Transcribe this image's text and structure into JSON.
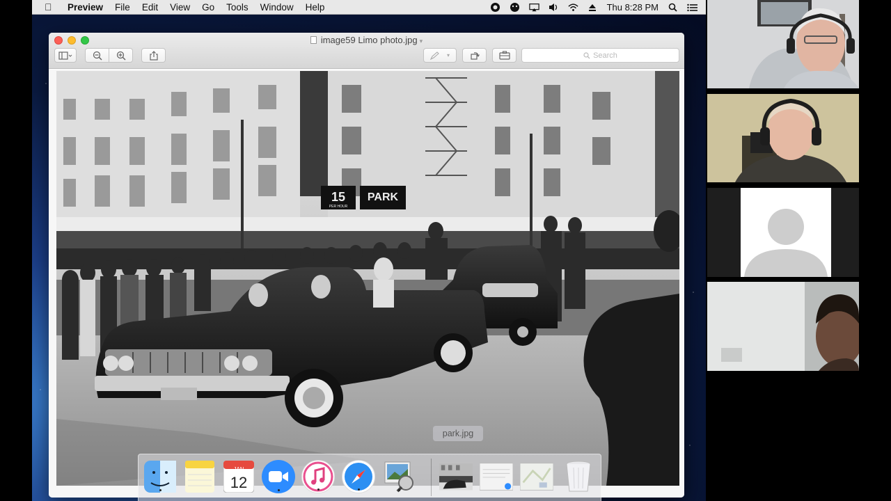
{
  "menubar": {
    "app_name": "Preview",
    "menus": [
      "File",
      "Edit",
      "View",
      "Go",
      "Tools",
      "Window",
      "Help"
    ],
    "clock": "Thu 8:28 PM"
  },
  "window": {
    "title": "image59 Limo photo.jpg",
    "search_placeholder": "Search"
  },
  "photo": {
    "sign_15": "15",
    "sign_per_hour": "PER HOUR",
    "sign_park": "PARK"
  },
  "dock": {
    "tooltip": "park.jpg",
    "calendar_month": "JAN",
    "calendar_day": "12"
  },
  "participants": [
    {
      "kind": "video",
      "name": ""
    },
    {
      "kind": "video",
      "name": ""
    },
    {
      "kind": "avatar",
      "name": ""
    },
    {
      "kind": "video",
      "name": ""
    }
  ],
  "colors": {
    "menubar_bg": "#e8e8e8",
    "close_button": "#fc5f57",
    "minimize_button": "#fdbc2e",
    "zoom_button": "#33c748",
    "zoom_icon": "#2d8cff"
  }
}
